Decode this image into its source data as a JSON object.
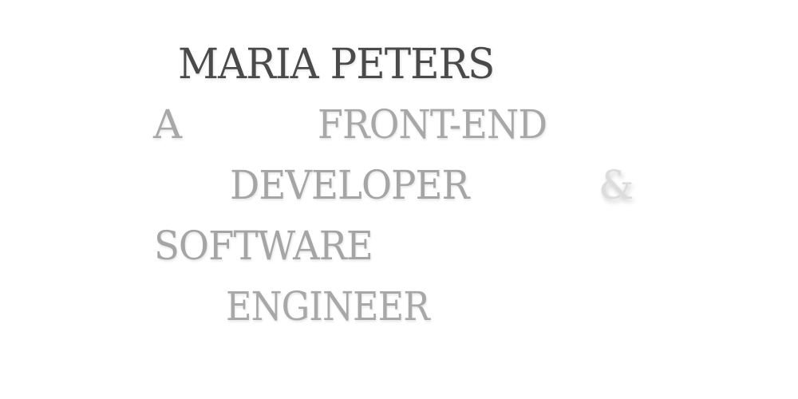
{
  "hero": {
    "name": "MARIA PETERS",
    "line_a": "A",
    "line_frontend": "FRONT-END",
    "line_developer": "DEVELOPER",
    "line_ampersand": "&",
    "line_software": "SOFTWARE",
    "line_engineer": "ENGINEER"
  },
  "colors": {
    "background": "#ffffff",
    "name_text": "#4a4a4a",
    "tagline_text": "#a8a8a8",
    "ampersand_text": "#dcdcdc"
  }
}
